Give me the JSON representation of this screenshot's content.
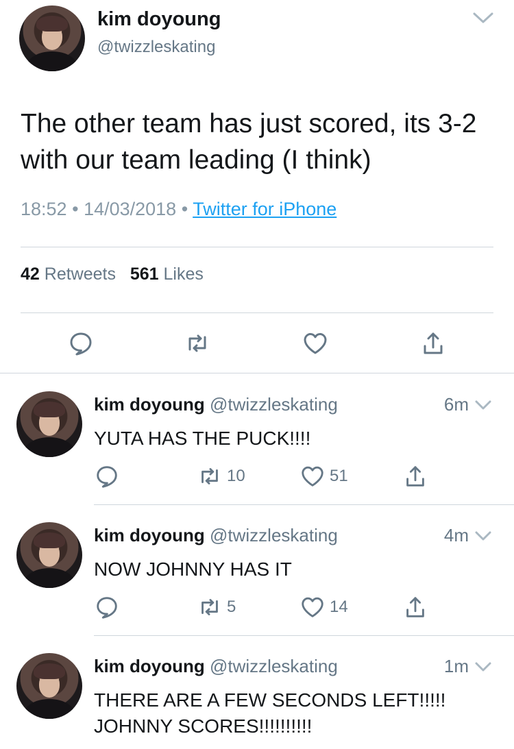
{
  "tweet": {
    "name": "kim doyoung",
    "handle": "@twizzleskating",
    "text": "The other team has just scored, its 3-2 with our team leading (I think)",
    "time": "18:52",
    "date": "14/03/2018",
    "client": "Twitter for iPhone",
    "retweets_count": "42",
    "retweets_label": "Retweets",
    "likes_count": "561",
    "likes_label": "Likes",
    "separator": "•"
  },
  "replies": [
    {
      "name": "kim doyoung",
      "handle": "@twizzleskating",
      "time": "6m",
      "text": "YUTA HAS THE PUCK!!!!",
      "retweets": "10",
      "likes": "51"
    },
    {
      "name": "kim doyoung",
      "handle": "@twizzleskating",
      "time": "4m",
      "text": "NOW JOHNNY HAS IT",
      "retweets": "5",
      "likes": "14"
    },
    {
      "name": "kim doyoung",
      "handle": "@twizzleskating",
      "time": "1m",
      "text": "THERE ARE A FEW SECONDS LEFT!!!!! JOHNNY SCORES!!!!!!!!!!",
      "retweets": "",
      "likes": ""
    }
  ],
  "icons": [
    "chevron-down-icon",
    "reply-icon",
    "retweet-icon",
    "like-icon",
    "share-icon"
  ],
  "colors": {
    "text": "#14171a",
    "secondary": "#657786",
    "meta": "#8899a6",
    "link": "#1da1f2",
    "divider": "#cfd6dc",
    "icon": "#657786"
  }
}
